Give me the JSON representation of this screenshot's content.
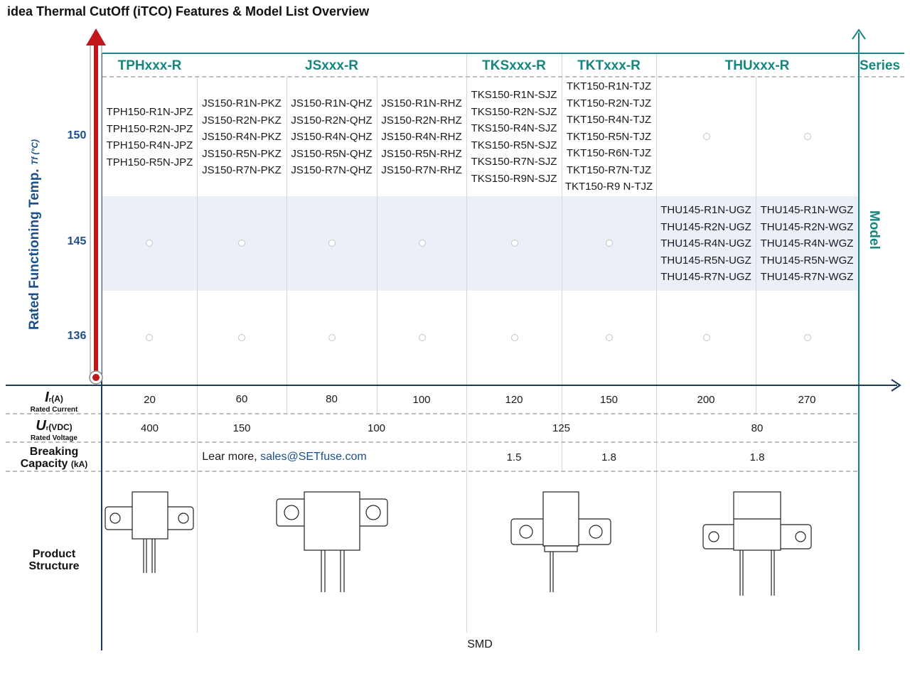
{
  "title": "idea Thermal CutOff (iTCO) Features & Model List Overview",
  "y_axis": {
    "title": "Rated Functioning Temp. ",
    "symbol": "Tf (°C)"
  },
  "series_axis_label": "Series",
  "model_axis_label": "Model",
  "temperatures": [
    "150",
    "145",
    "136"
  ],
  "series": [
    "TPHxxx-R",
    "JSxxx-R",
    "TKSxxx-R",
    "TKTxxx-R",
    "THUxxx-R"
  ],
  "models": {
    "tph": [
      "TPH150-R1N-JPZ",
      "TPH150-R2N-JPZ",
      "TPH150-R4N-JPZ",
      "TPH150-R5N-JPZ"
    ],
    "js_pkz": [
      "JS150-R1N-PKZ",
      "JS150-R2N-PKZ",
      "JS150-R4N-PKZ",
      "JS150-R5N-PKZ",
      "JS150-R7N-PKZ"
    ],
    "js_qhz": [
      "JS150-R1N-QHZ",
      "JS150-R2N-QHZ",
      "JS150-R4N-QHZ",
      "JS150-R5N-QHZ",
      "JS150-R7N-QHZ"
    ],
    "js_rhz": [
      "JS150-R1N-RHZ",
      "JS150-R2N-RHZ",
      "JS150-R4N-RHZ",
      "JS150-R5N-RHZ",
      "JS150-R7N-RHZ"
    ],
    "tks": [
      "TKS150-R1N-SJZ",
      "TKS150-R2N-SJZ",
      "TKS150-R4N-SJZ",
      "TKS150-R5N-SJZ",
      "TKS150-R7N-SJZ",
      "TKS150-R9N-SJZ"
    ],
    "tkt": [
      "TKT150-R1N-TJZ",
      "TKT150-R2N-TJZ",
      "TKT150-R4N-TJZ",
      "TKT150-R5N-TJZ",
      "TKT150-R6N-TJZ",
      "TKT150-R7N-TJZ",
      "TKT150-R9 N-TJZ"
    ],
    "thu_ugz": [
      "THU145-R1N-UGZ",
      "THU145-R2N-UGZ",
      "THU145-R4N-UGZ",
      "THU145-R5N-UGZ",
      "THU145-R7N-UGZ"
    ],
    "thu_wgz": [
      "THU145-R1N-WGZ",
      "THU145-R2N-WGZ",
      "THU145-R4N-WGZ",
      "THU145-R5N-WGZ",
      "THU145-R7N-WGZ"
    ]
  },
  "rows": {
    "current": {
      "symbol": "I",
      "sub": "r",
      "unit": "(A)",
      "caption": "Rated Current",
      "values": [
        "20",
        "60",
        "80",
        "100",
        "120",
        "150",
        "200",
        "270"
      ]
    },
    "voltage": {
      "symbol": "U",
      "sub": "r",
      "unit": "(VDC)",
      "caption": "Rated Voltage",
      "values": [
        "400",
        "150",
        "100",
        "125",
        "80"
      ]
    },
    "breaking": {
      "line1": "Breaking",
      "line2": "Capacity",
      "unit": "(kA)",
      "learn_prefix": "Lear more, ",
      "email": "sales@SETfuse.com",
      "values": [
        "1.5",
        "1.8",
        "1.8"
      ]
    },
    "structure": {
      "line1": "Product",
      "line2": "Structure"
    }
  },
  "footer": "SMD",
  "colors": {
    "temp_axis": "#c0161c",
    "series_axis": "#16867f",
    "navy": "#1b3a5c",
    "band": "#eaeff8"
  }
}
